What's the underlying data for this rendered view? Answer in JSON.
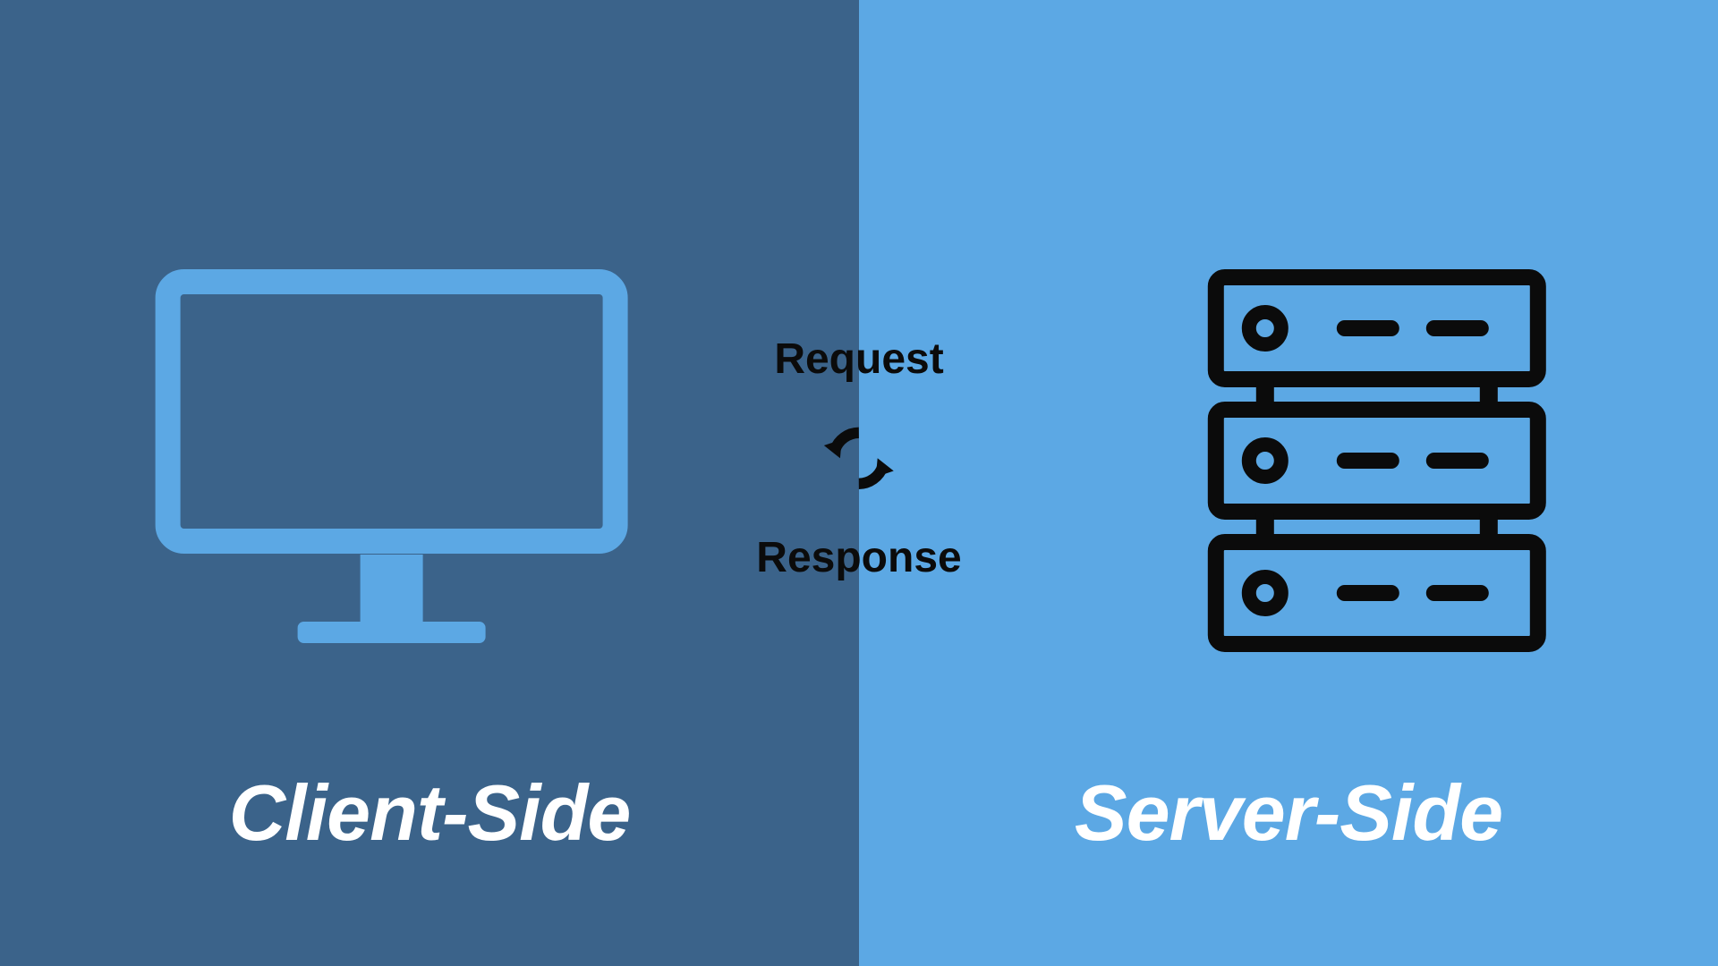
{
  "left": {
    "title": "Client-Side",
    "bg_color": "#3b638a",
    "icon_stroke": "#5ca8e4"
  },
  "right": {
    "title": "Server-Side",
    "bg_color": "#5ca8e4",
    "icon_stroke": "#0b0b0b"
  },
  "center": {
    "request_label": "Request",
    "response_label": "Response",
    "icon_color": "#0b0b0b"
  },
  "colors": {
    "white": "#ffffff",
    "black": "#0b0b0b"
  }
}
